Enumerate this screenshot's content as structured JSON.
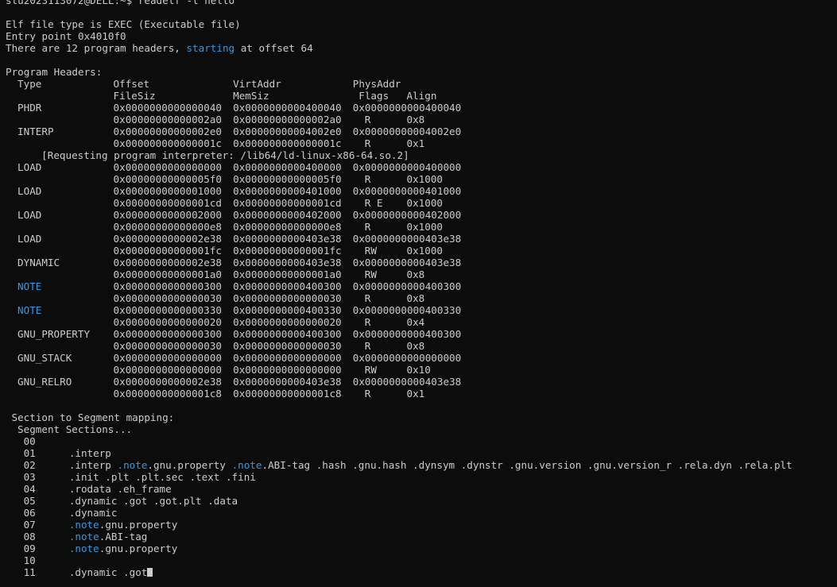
{
  "colors": {
    "background": "#0c0c0c",
    "foreground": "#cccccc",
    "highlight": "#3a96dd"
  },
  "prompt": {
    "user_host": "stu2023113072@DELL",
    "path": "~",
    "symbol": "$",
    "command": "readelf -l hello"
  },
  "header": {
    "file_type": "Elf file type is EXEC (Executable file)",
    "entry_point": "Entry point 0x4010f0",
    "count_prefix": "There are 12 program headers, ",
    "count_keyword": "starting",
    "count_suffix": " at offset 64"
  },
  "program_headers": {
    "title": "Program Headers:",
    "col_type": "Type",
    "col_offset": "Offset",
    "col_virtaddr": "VirtAddr",
    "col_physaddr": "PhysAddr",
    "col_filesiz": "FileSiz",
    "col_memsiz": "MemSiz",
    "col_flags": "Flags",
    "col_align": "Align",
    "rows": [
      {
        "type": "PHDR",
        "offset": "0x0000000000000040",
        "virt": "0x0000000000400040",
        "phys": "0x0000000000400040",
        "filesz": "0x00000000000002a0",
        "memsz": "0x00000000000002a0",
        "flags": "R",
        "align": "0x8"
      },
      {
        "type": "INTERP",
        "offset": "0x00000000000002e0",
        "virt": "0x00000000004002e0",
        "phys": "0x00000000004002e0",
        "filesz": "0x000000000000001c",
        "memsz": "0x000000000000001c",
        "flags": "R",
        "align": "0x1"
      },
      {
        "type": "LOAD",
        "offset": "0x0000000000000000",
        "virt": "0x0000000000400000",
        "phys": "0x0000000000400000",
        "filesz": "0x00000000000005f0",
        "memsz": "0x00000000000005f0",
        "flags": "R",
        "align": "0x1000"
      },
      {
        "type": "LOAD",
        "offset": "0x0000000000001000",
        "virt": "0x0000000000401000",
        "phys": "0x0000000000401000",
        "filesz": "0x00000000000001cd",
        "memsz": "0x00000000000001cd",
        "flags": "R E",
        "align": "0x1000"
      },
      {
        "type": "LOAD",
        "offset": "0x0000000000002000",
        "virt": "0x0000000000402000",
        "phys": "0x0000000000402000",
        "filesz": "0x00000000000000e8",
        "memsz": "0x00000000000000e8",
        "flags": "R",
        "align": "0x1000"
      },
      {
        "type": "LOAD",
        "offset": "0x0000000000002e38",
        "virt": "0x0000000000403e38",
        "phys": "0x0000000000403e38",
        "filesz": "0x00000000000001fc",
        "memsz": "0x00000000000001fc",
        "flags": "RW",
        "align": "0x1000"
      },
      {
        "type": "DYNAMIC",
        "offset": "0x0000000000002e38",
        "virt": "0x0000000000403e38",
        "phys": "0x0000000000403e38",
        "filesz": "0x00000000000001a0",
        "memsz": "0x00000000000001a0",
        "flags": "RW",
        "align": "0x8"
      },
      {
        "type": "NOTE",
        "offset": "0x0000000000000300",
        "virt": "0x0000000000400300",
        "phys": "0x0000000000400300",
        "filesz": "0x0000000000000030",
        "memsz": "0x0000000000000030",
        "flags": "R",
        "align": "0x8"
      },
      {
        "type": "NOTE",
        "offset": "0x0000000000000330",
        "virt": "0x0000000000400330",
        "phys": "0x0000000000400330",
        "filesz": "0x0000000000000020",
        "memsz": "0x0000000000000020",
        "flags": "R",
        "align": "0x4"
      },
      {
        "type": "GNU_PROPERTY",
        "offset": "0x0000000000000300",
        "virt": "0x0000000000400300",
        "phys": "0x0000000000400300",
        "filesz": "0x0000000000000030",
        "memsz": "0x0000000000000030",
        "flags": "R",
        "align": "0x8"
      },
      {
        "type": "GNU_STACK",
        "offset": "0x0000000000000000",
        "virt": "0x0000000000000000",
        "phys": "0x0000000000000000",
        "filesz": "0x0000000000000000",
        "memsz": "0x0000000000000000",
        "flags": "RW",
        "align": "0x10"
      },
      {
        "type": "GNU_RELRO",
        "offset": "0x0000000000002e38",
        "virt": "0x0000000000403e38",
        "phys": "0x0000000000403e38",
        "filesz": "0x00000000000001c8",
        "memsz": "0x00000000000001c8",
        "flags": "R",
        "align": "0x1"
      }
    ],
    "interp_note": "[Requesting program interpreter: /lib64/ld-linux-x86-64.so.2]"
  },
  "mapping": {
    "title": "Section to Segment mapping:",
    "header": "Segment Sections...",
    "segments": [
      {
        "seg": "00",
        "sections": ""
      },
      {
        "seg": "01",
        "sections": ".interp"
      },
      {
        "seg": "02",
        "sections": ".interp .note.gnu.property .note.ABI-tag .hash .gnu.hash .dynsym .dynstr .gnu.version .gnu.version_r .rela.dyn .rela.plt"
      },
      {
        "seg": "03",
        "sections": ".init .plt .plt.sec .text .fini"
      },
      {
        "seg": "04",
        "sections": ".rodata .eh_frame"
      },
      {
        "seg": "05",
        "sections": ".dynamic .got .got.plt .data"
      },
      {
        "seg": "06",
        "sections": ".dynamic"
      },
      {
        "seg": "07",
        "sections": ".note.gnu.property"
      },
      {
        "seg": "08",
        "sections": ".note.ABI-tag"
      },
      {
        "seg": "09",
        "sections": ".note.gnu.property"
      },
      {
        "seg": "10",
        "sections": ""
      },
      {
        "seg": "11",
        "sections": ".dynamic .got"
      }
    ]
  }
}
